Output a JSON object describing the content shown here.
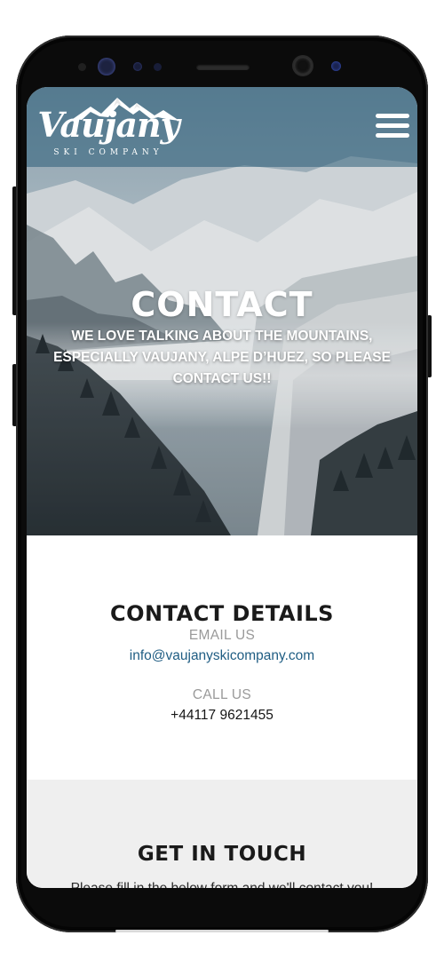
{
  "header": {
    "logo_name": "Vaujany",
    "logo_sub": "SKI COMPANY",
    "menu_icon": "hamburger-menu-icon"
  },
  "hero": {
    "title": "CONTACT",
    "text": "WE LOVE TALKING ABOUT THE MOUNTAINS, ESPECIALLY VAUJANY, ALPE D’HUEZ,  SO PLEASE CONTACT US!!"
  },
  "details": {
    "heading": "CONTACT DETAILS",
    "email_label": "EMAIL US",
    "email": "info@vaujanyskicompany.com",
    "phone_label": "CALL US",
    "phone": "+44117 9621455"
  },
  "touch": {
    "heading": "GET IN TOUCH",
    "text": "Please fill in the below form and we'll contact you!"
  },
  "colors": {
    "header_overlay": "#2c5c78",
    "email_link": "#1f5d83",
    "touch_background": "#efefef"
  }
}
